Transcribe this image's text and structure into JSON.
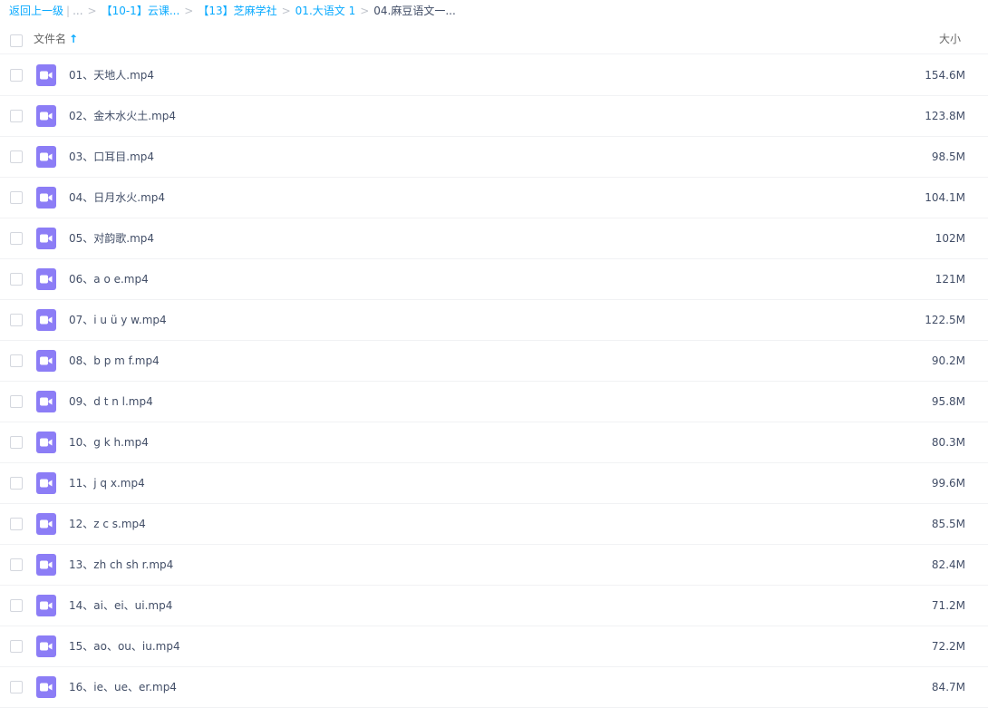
{
  "breadcrumb": {
    "back": "返回上一级",
    "ellipsis": "...",
    "items": [
      "【10-1】云课...",
      "【13】芝麻学社",
      "01.大语文 1"
    ],
    "current": "04.麻豆语文一..."
  },
  "header": {
    "name_label": "文件名",
    "sort_arrow": "↑",
    "size_label": "大小"
  },
  "files": [
    {
      "name": "01、天地人.mp4",
      "size": "154.6M",
      "icon": "video-icon"
    },
    {
      "name": "02、金木水火土.mp4",
      "size": "123.8M",
      "icon": "video-icon"
    },
    {
      "name": "03、口耳目.mp4",
      "size": "98.5M",
      "icon": "video-icon"
    },
    {
      "name": "04、日月水火.mp4",
      "size": "104.1M",
      "icon": "video-icon"
    },
    {
      "name": "05、对韵歌.mp4",
      "size": "102M",
      "icon": "video-icon"
    },
    {
      "name": "06、a o e.mp4",
      "size": "121M",
      "icon": "video-icon"
    },
    {
      "name": "07、i u ü y w.mp4",
      "size": "122.5M",
      "icon": "video-icon"
    },
    {
      "name": "08、b p m f.mp4",
      "size": "90.2M",
      "icon": "video-icon"
    },
    {
      "name": "09、d t n l.mp4",
      "size": "95.8M",
      "icon": "video-icon"
    },
    {
      "name": "10、g k h.mp4",
      "size": "80.3M",
      "icon": "video-icon"
    },
    {
      "name": "11、j q x.mp4",
      "size": "99.6M",
      "icon": "video-icon"
    },
    {
      "name": "12、z c s.mp4",
      "size": "85.5M",
      "icon": "video-icon"
    },
    {
      "name": "13、zh ch sh r.mp4",
      "size": "82.4M",
      "icon": "video-icon"
    },
    {
      "name": "14、ai、ei、ui.mp4",
      "size": "71.2M",
      "icon": "video-icon"
    },
    {
      "name": "15、ao、ou、iu.mp4",
      "size": "72.2M",
      "icon": "video-icon"
    },
    {
      "name": "16、ie、ue、er.mp4",
      "size": "84.7M",
      "icon": "video-icon"
    }
  ],
  "colors": {
    "link": "#09aaff",
    "video_icon": "#8c7df6",
    "text": "#424e67"
  }
}
